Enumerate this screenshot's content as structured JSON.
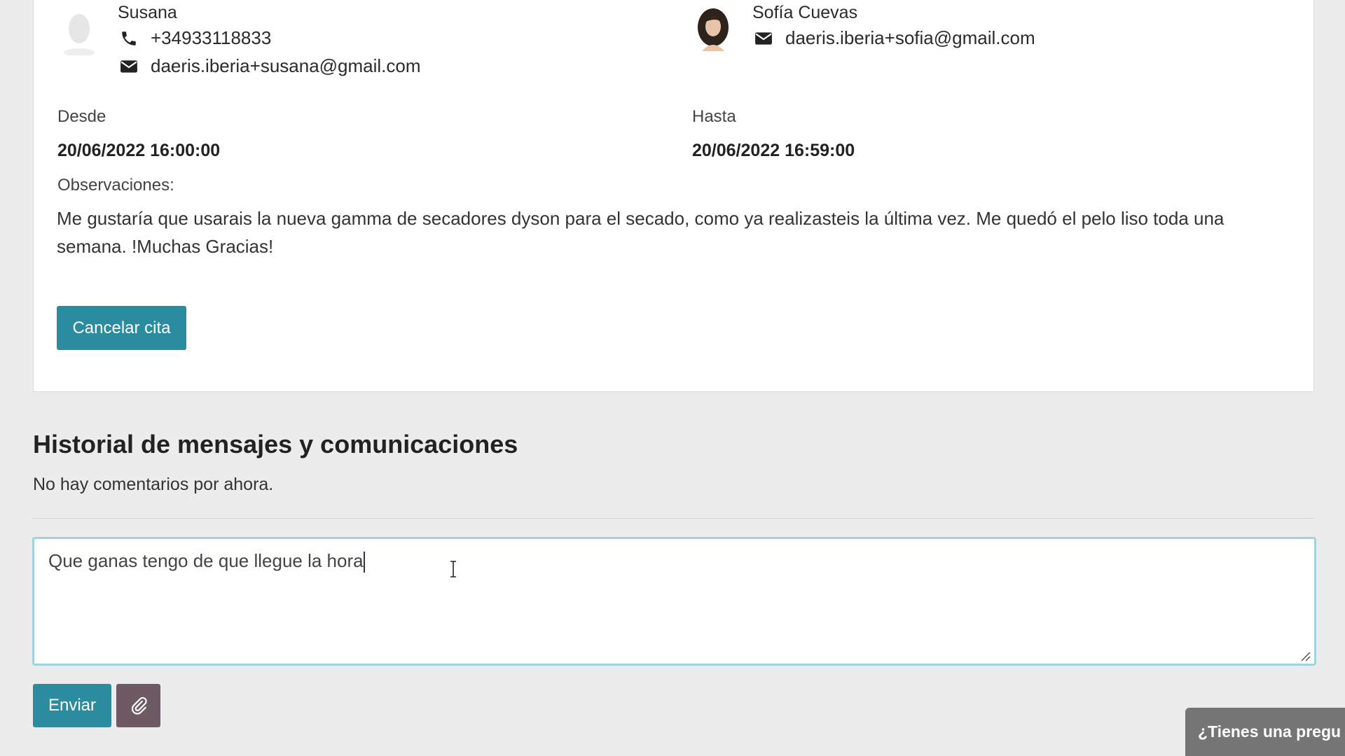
{
  "appointment": {
    "client": {
      "name": "Susana",
      "phone": "+34933118833",
      "email": "daeris.iberia+susana@gmail.com"
    },
    "professional": {
      "name": "Sofía Cuevas",
      "email": "daeris.iberia+sofia@gmail.com"
    },
    "from_label": "Desde",
    "from_value": "20/06/2022 16:00:00",
    "to_label": "Hasta",
    "to_value": "20/06/2022 16:59:00",
    "observations_label": "Observaciones:",
    "observations_text": "Me gustaría que usarais la nueva gamma de secadores dyson para el secado, como ya realizasteis la última vez. Me quedó el pelo liso toda una semana. !Muchas Gracias!",
    "cancel_label": "Cancelar cita"
  },
  "history": {
    "title": "Historial de mensajes y comunicaciones",
    "empty_text": "No hay comentarios por ahora.",
    "message_value": "Que ganas tengo de que llegue la hora",
    "send_label": "Enviar"
  },
  "chat_widget": {
    "label": "¿Tienes una pregu"
  },
  "icons": {
    "phone": "phone-icon",
    "email": "envelope-icon",
    "attach": "paperclip-icon"
  },
  "colors": {
    "primary": "#2a8c9e",
    "secondary": "#6e5a64",
    "background": "#ececec",
    "focus_border": "#9fd3dd"
  }
}
